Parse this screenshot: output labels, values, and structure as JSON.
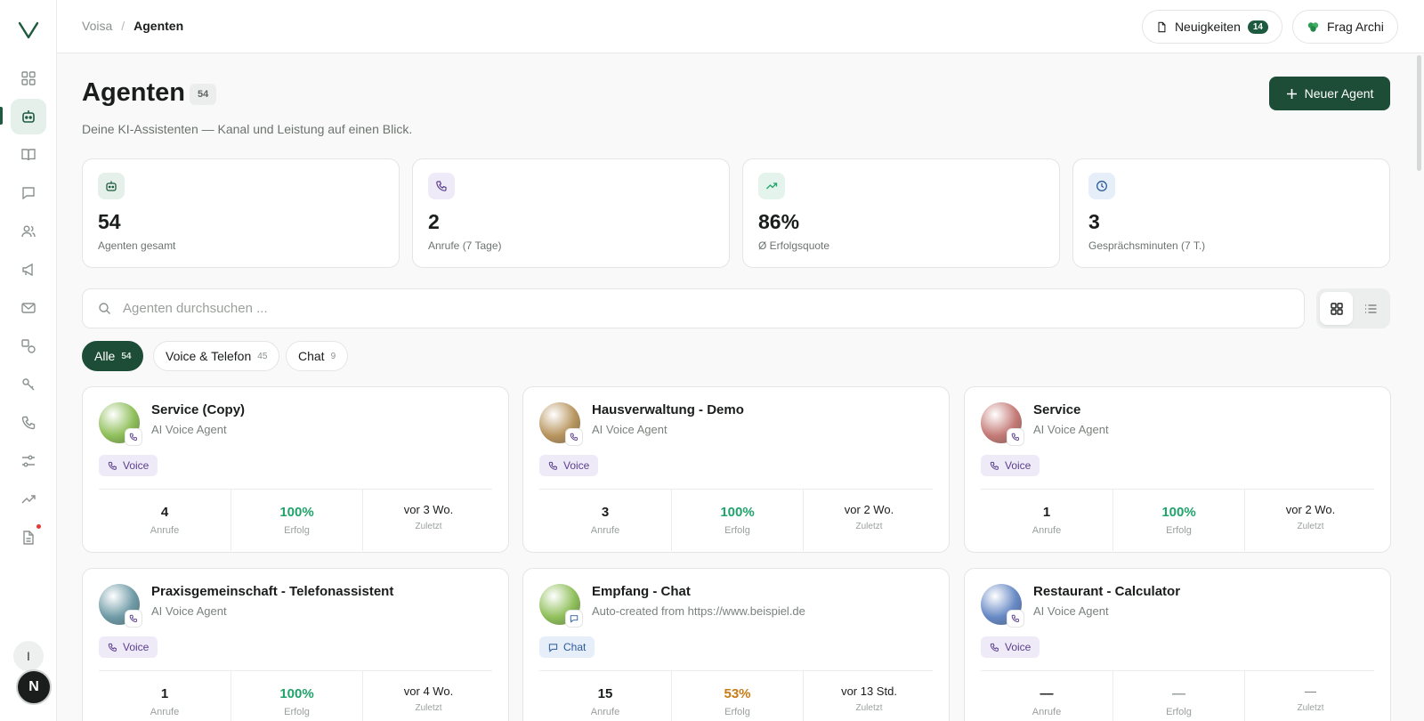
{
  "breadcrumb": {
    "root": "Voisa",
    "separator": "/",
    "current": "Agenten"
  },
  "topbar": {
    "news_label": "Neuigkeiten",
    "news_count": "14",
    "ask_label": "Frag Archi"
  },
  "header": {
    "title": "Agenten",
    "count": "54",
    "subtitle": "Deine KI-Assistenten — Kanal und Leistung auf einen Blick.",
    "new_button": "Neuer Agent"
  },
  "stats": [
    {
      "value": "54",
      "label": "Agenten gesamt",
      "icon": "bot-icon",
      "color": "#e6f0ea"
    },
    {
      "value": "2",
      "label": "Anrufe (7 Tage)",
      "icon": "phone-icon",
      "color": "#efeaf7"
    },
    {
      "value": "86%",
      "label": "Ø Erfolgsquote",
      "icon": "trend-up-icon",
      "color": "#e4f4ec"
    },
    {
      "value": "3",
      "label": "Gesprächsminuten (7 T.)",
      "icon": "clock-icon",
      "color": "#e6eef9"
    }
  ],
  "search": {
    "placeholder": "Agenten durchsuchen ..."
  },
  "filters": [
    {
      "label": "Alle",
      "count": "54",
      "active": true
    },
    {
      "label": "Voice & Telefon",
      "count": "45",
      "active": false
    },
    {
      "label": "Chat",
      "count": "9",
      "active": false
    }
  ],
  "metric_labels": {
    "calls": "Anrufe",
    "success": "Erfolg",
    "last": "Zuletzt"
  },
  "agents": [
    {
      "name": "Service (Copy)",
      "type": "AI Voice Agent",
      "channel": "Voice",
      "calls": "4",
      "success": "100%",
      "last": "vor 3 Wo.",
      "avatar_color": "#8fbf5a"
    },
    {
      "name": "Hausverwaltung - Demo",
      "type": "AI Voice Agent",
      "channel": "Voice",
      "calls": "3",
      "success": "100%",
      "last": "vor 2 Wo.",
      "avatar_color": "#b8955e"
    },
    {
      "name": "Service",
      "type": "AI Voice Agent",
      "channel": "Voice",
      "calls": "1",
      "success": "100%",
      "last": "vor 2 Wo.",
      "avatar_color": "#c47a76"
    },
    {
      "name": "Praxisgemeinschaft - Telefonassistent",
      "type": "AI Voice Agent",
      "channel": "Voice",
      "calls": "1",
      "success": "100%",
      "last": "vor 4 Wo.",
      "avatar_color": "#6e9aa6"
    },
    {
      "name": "Empfang - Chat",
      "type": "Auto-created from https://www.beispiel.de",
      "channel": "Chat",
      "calls": "15",
      "success": "53%",
      "last": "vor 13 Std.",
      "avatar_color": "#8fbf5a"
    },
    {
      "name": "Restaurant - Calculator",
      "type": "AI Voice Agent",
      "channel": "Voice",
      "calls": "—",
      "success": "—",
      "last": "—",
      "avatar_color": "#6688c4"
    }
  ]
}
